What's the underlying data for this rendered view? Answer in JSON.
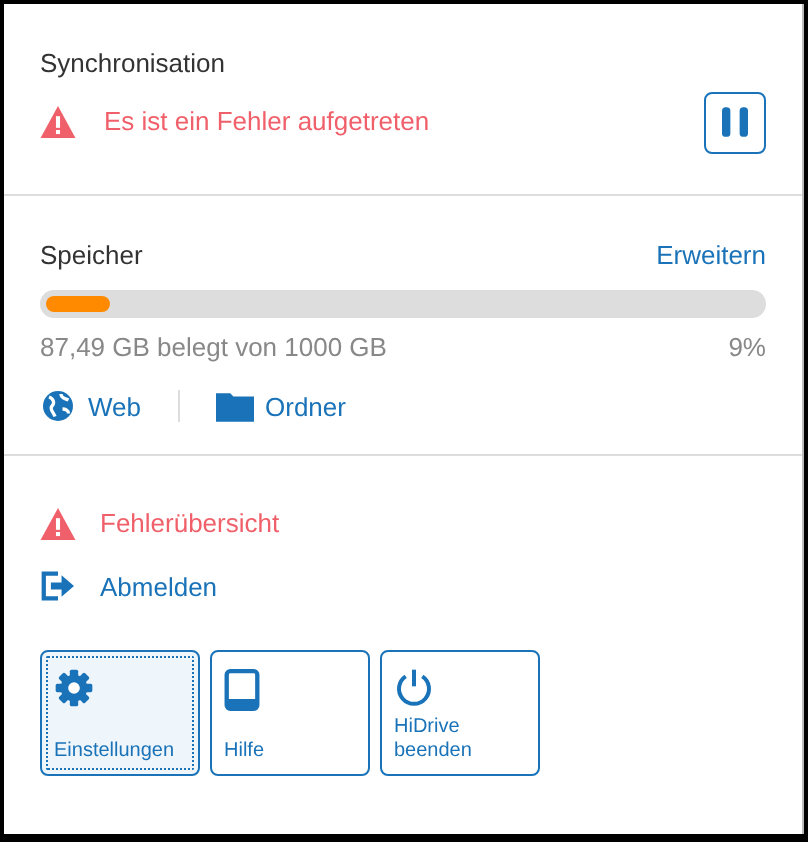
{
  "sync": {
    "title": "Synchronisation",
    "status": "Es ist ein Fehler aufgetreten",
    "error": true,
    "paused": false
  },
  "storage": {
    "title": "Speicher",
    "action": "Erweitern",
    "level": 0.09,
    "used": "87,49 GB belegt von 1000 GB",
    "percent": "9%"
  },
  "links": [
    {
      "kind": "web",
      "label": "Web"
    },
    {
      "kind": "folder",
      "label": "Ordner"
    }
  ],
  "menu": [
    {
      "kind": "error",
      "label": "Fehlerübersicht"
    },
    {
      "kind": "logout",
      "label": "Abmelden"
    }
  ],
  "buttons": [
    {
      "kind": "settings",
      "label": "Einstellungen",
      "focused": true
    },
    {
      "kind": "help",
      "label": "Hilfe",
      "focused": false
    },
    {
      "kind": "quit",
      "label": "HiDrive beenden",
      "focused": false
    }
  ]
}
